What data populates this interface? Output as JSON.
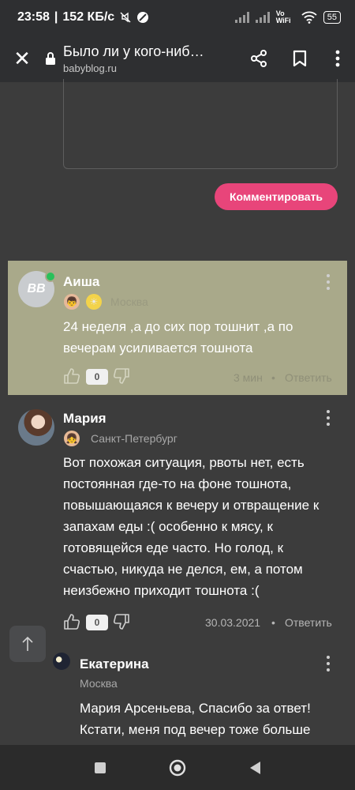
{
  "status_bar": {
    "time": "23:58",
    "speed": "152 КБ/с",
    "network": "Vo WiFi",
    "battery": "55"
  },
  "app_bar": {
    "title": "Было ли у кого-ниб…",
    "url": "babyblog.ru"
  },
  "comment_button": "Комментировать",
  "comments": [
    {
      "author": "Аиша",
      "avatar_text": "BB",
      "city": "Москва",
      "text": "24 неделя ,а до сих пор тошнит ,а по вечерам усиливается тошнота",
      "likes": "0",
      "date": "3 мин",
      "reply": "Ответить",
      "highlighted": true,
      "online": true
    },
    {
      "author": "Мария",
      "city": "Санкт-Петербург",
      "text": "Вот похожая ситуация, рвоты нет, есть постоянная где-то на фоне тошнота, повышающаяся к вечеру и отвращение к запахам еды :( особенно к мясу, к готовящейся еде часто. Но голод, к счастью, никуда не делся, ем, а потом неизбежно приходит тошнота :(",
      "likes": "0",
      "date": "30.03.2021",
      "separator": "•",
      "reply": "Ответить"
    },
    {
      "author": "Екатерина",
      "city": "Москва",
      "text": "Мария Арсеньева, Спасибо за ответ! Кстати, меня под вечер тоже больше"
    }
  ],
  "colors": {
    "accent": "#e8457a",
    "highlight_bg": "#a9a98a",
    "page_bg": "#3c3c3c"
  }
}
